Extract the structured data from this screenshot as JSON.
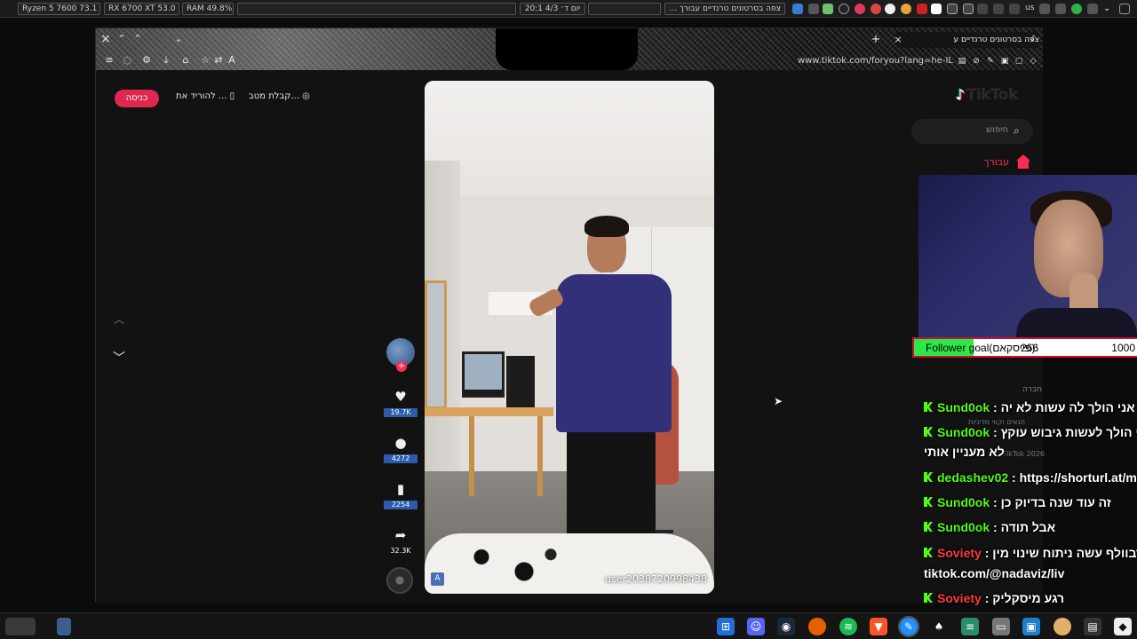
{
  "system_panel": {
    "cpu": "Ryzen 5 7600  73.1 °C",
    "gpu": "RX 6700 XT  53.0 °C",
    "ram": "RAM    49.8%",
    "clock": "20:1  יום ד׳  4/3",
    "window_title": "צפה בסרטונים טרנדיים עבורך ...",
    "keyboard_layout": "us"
  },
  "browser": {
    "tab_title": "צפה בסרטונים טרנדיים ע",
    "url": "www.tiktok.com/foryou?lang=he-IL",
    "new_tab": "+",
    "close": "×"
  },
  "tiktok": {
    "login_label": "כניסה",
    "download_link": "להוריד את ...",
    "coins_link": "קבלת מטב...",
    "logo_text": "TikTok",
    "search_placeholder": "חיפוש",
    "nav_foryou": "עבורך",
    "company_label": "חברה",
    "terms_label": "תנאים וקווי מדיניות",
    "copyright": "© TikTok 2026",
    "video_username": "user2038720998438",
    "likes": "19.7K",
    "comments": "4272",
    "bookmarks": "2254",
    "shares": "32.3K"
  },
  "stream_overlay": {
    "follower_goal_label": "Follower goal(פייסקאם):",
    "follower_current": "266",
    "follower_target": "1000",
    "follower_progress": 0.266,
    "chat": [
      {
        "user": "Sund0ok",
        "message": "אח אני הולך לה עשות לא יה...",
        "color": "green"
      },
      {
        "user": "Sund0ok",
        "message": "אני הולך לעשות גיבוש עוקץ",
        "color": "green"
      },
      {
        "user": "",
        "message": "לא מעניין אותי",
        "color": "none"
      },
      {
        "user": "dedashev02",
        "message": "https://shorturl.at/mJZOB",
        "color": "green"
      },
      {
        "user": "Sund0ok",
        "message": "זה עוד שנה בדיוק כן",
        "color": "green"
      },
      {
        "user": "Sund0ok",
        "message": "אבל תודה",
        "color": "green"
      },
      {
        "user": "Soviety",
        "message": "נדבוולף עשה ניתוח שינוי מין?",
        "color": "red"
      },
      {
        "user": "",
        "message": "tiktok.com/@nadaviz/liv",
        "color": "none"
      },
      {
        "user": "Soviety",
        "message": "רגע מיסקליק",
        "color": "red"
      }
    ]
  }
}
